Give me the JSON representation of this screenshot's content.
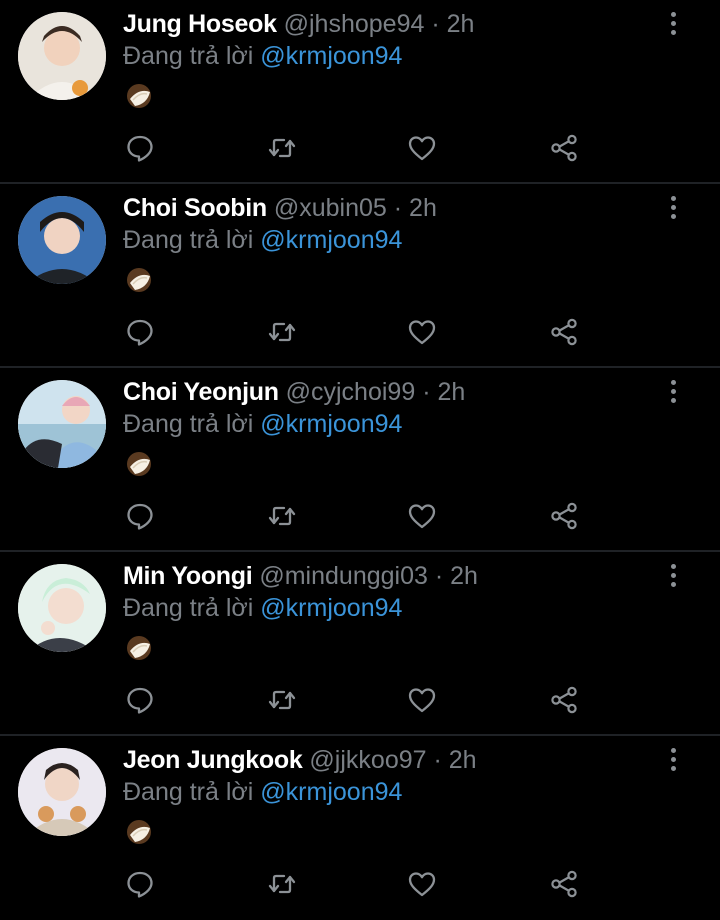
{
  "reply_prefix": "Đang trả lời",
  "colors": {
    "background": "#000000",
    "muted": "#7b8086",
    "mention": "#3b94d9"
  },
  "icons": {
    "reply": "reply-icon",
    "retweet": "retweet-icon",
    "like": "heart-icon",
    "share": "share-icon",
    "more": "more-vertical-icon",
    "emoji": "coconut-emoji"
  },
  "tweets": [
    {
      "name": "Jung Hoseok",
      "handle": "@jhshope94",
      "dot": "·",
      "time": "2h",
      "reply_to": "@krmjoon94",
      "emoji": "🥥"
    },
    {
      "name": "Choi Soobin",
      "handle": "@xubin05",
      "dot": "·",
      "time": "2h",
      "reply_to": "@krmjoon94",
      "emoji": "🥥"
    },
    {
      "name": "Choi Yeonjun",
      "handle": "@cyjchoi99",
      "dot": "·",
      "time": "2h",
      "reply_to": "@krmjoon94",
      "emoji": "🥥"
    },
    {
      "name": "Min Yoongi",
      "handle": "@mindunggi03",
      "dot": "·",
      "time": "2h",
      "reply_to": "@krmjoon94",
      "emoji": "🥥"
    },
    {
      "name": "Jeon Jungkook",
      "handle": "@jjkkoo97",
      "dot": "·",
      "time": "2h",
      "reply_to": "@krmjoon94",
      "emoji": "🥥"
    }
  ]
}
